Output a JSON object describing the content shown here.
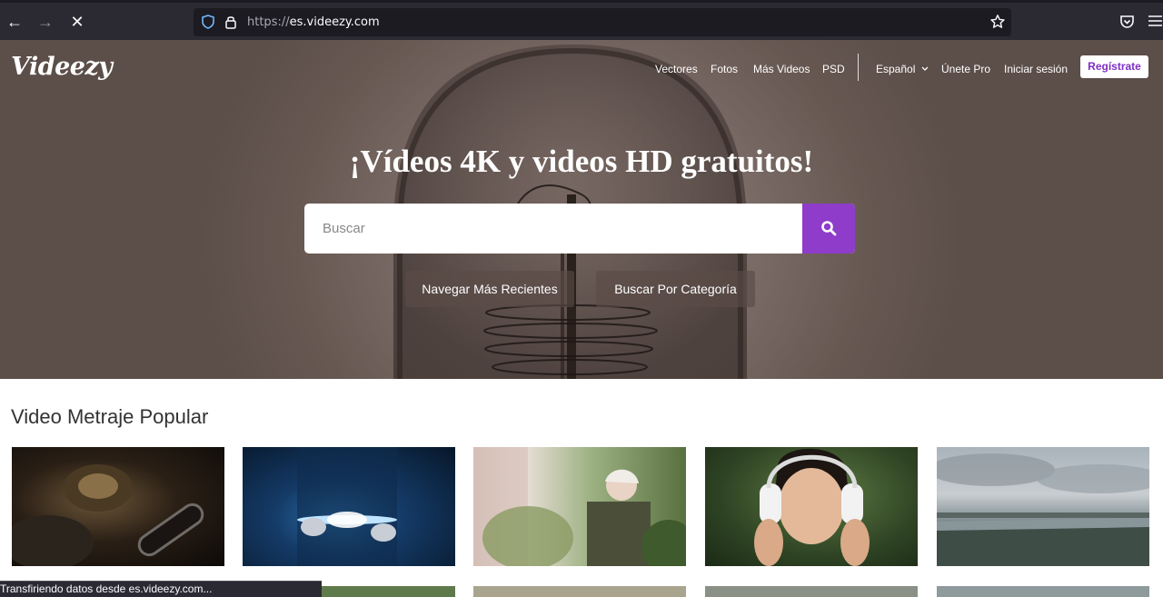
{
  "browser": {
    "url_proto": "https://",
    "url_host": "es.videezy.com",
    "status": "Transfiriendo datos desde es.videezy.com..."
  },
  "site": {
    "logo": "Videezy",
    "nav": [
      {
        "label": "Vectores"
      },
      {
        "label": "Fotos"
      },
      {
        "label": "Más Videos"
      },
      {
        "label": "PSD"
      },
      {
        "label": "Español"
      },
      {
        "label": "Únete Pro"
      },
      {
        "label": "Iniciar sesión"
      }
    ],
    "register_label": "Regístrate"
  },
  "hero": {
    "headline": "¡Vídeos 4K y videos HD gratuitos!",
    "search_placeholder": "Buscar",
    "browse_recent": "Navegar Más Recientes",
    "browse_category": "Buscar Por Categoría"
  },
  "popular": {
    "title": "Video Metraje Popular"
  },
  "colors": {
    "accent": "#8e3cc9",
    "register_text": "#7e2fc4"
  }
}
